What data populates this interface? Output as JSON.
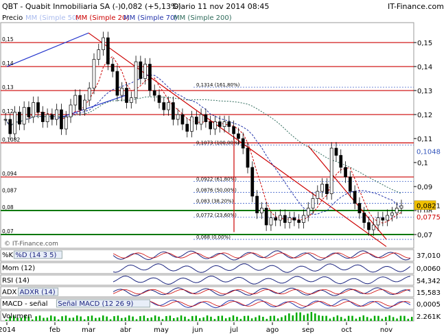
{
  "header": {
    "ticker": "QBT - Quabit Inmobiliaria SA (-)",
    "quote": "0,082 (+5,13%)",
    "period": "Diario",
    "datetime": "11 nov 2014 08:45",
    "source": "IT-Finance.com"
  },
  "legend": {
    "precio": "Precio",
    "mm50": "MM (Simple 50)",
    "mm20": "MM (Simple 20)",
    "mm70": "MM (Simple 70)",
    "mm200": "MM (Simple 200)"
  },
  "watermark": "© IT-Finance.com",
  "chart_data": {
    "type": "candlestick",
    "period": "Diario",
    "y_axis_labels": [
      "0,15",
      "0,14",
      "0,13",
      "0,12",
      "0,11",
      "0,1",
      "0,09",
      "0,08",
      "0,07"
    ],
    "y_axis_values": [
      0.15,
      0.14,
      0.13,
      0.12,
      0.11,
      0.1,
      0.09,
      0.08,
      0.07
    ],
    "ylim": [
      0.0643,
      0.1583
    ],
    "x_axis_labels": [
      "2014",
      "feb",
      "mar",
      "abr",
      "may",
      "jun",
      "jul",
      "ago",
      "sep",
      "oct",
      "nov"
    ],
    "left_labels": [
      {
        "text": "0,15",
        "value": 0.15
      },
      {
        "text": "0,14",
        "value": 0.14
      },
      {
        "text": "0,13",
        "value": 0.13
      },
      {
        "text": "0,12",
        "value": 0.12
      },
      {
        "text": "0,1082",
        "value": 0.1082
      },
      {
        "text": "0,094",
        "value": 0.094
      },
      {
        "text": "0,087",
        "value": 0.087
      },
      {
        "text": "0,08",
        "value": 0.08
      },
      {
        "text": "0,07",
        "value": 0.07
      }
    ],
    "last_price": {
      "label": "0,0821",
      "value": 0.0821,
      "color": "#f0c000"
    },
    "price_tags": [
      {
        "label": "0,1048",
        "value": 0.1048,
        "color": "#3355bb"
      },
      {
        "label": "0,0775",
        "value": 0.0775,
        "color": "#cc0000"
      }
    ],
    "fibonacci": [
      {
        "label": "0,1314 (161,80%)",
        "value": 0.1314
      },
      {
        "label": "0,1073 (100,00%)",
        "value": 0.1073
      },
      {
        "label": "0,0922 (61,80%)",
        "value": 0.0922
      },
      {
        "label": "0,0876 (50,00%)",
        "value": 0.0876
      },
      {
        "label": "0,083 (38,20%)",
        "value": 0.083
      },
      {
        "label": "0,0772 (23,60%)",
        "value": 0.0772
      },
      {
        "label": "0,068 (0,00%)",
        "value": 0.068
      }
    ],
    "horizontal_lines": [
      {
        "value": 0.15,
        "color": "#cc0000"
      },
      {
        "value": 0.14,
        "color": "#cc0000"
      },
      {
        "value": 0.13,
        "color": "#cc0000"
      },
      {
        "value": 0.12,
        "color": "#cc0000"
      },
      {
        "value": 0.1082,
        "color": "#cc0000"
      },
      {
        "value": 0.094,
        "color": "#cc0000"
      },
      {
        "value": 0.08,
        "color": "#007700"
      },
      {
        "value": 0.07,
        "color": "#007700"
      }
    ],
    "close_series": [
      0.118,
      0.112,
      0.121,
      0.116,
      0.123,
      0.119,
      0.125,
      0.121,
      0.117,
      0.12,
      0.118,
      0.122,
      0.114,
      0.119,
      0.124,
      0.128,
      0.122,
      0.126,
      0.131,
      0.143,
      0.147,
      0.152,
      0.141,
      0.138,
      0.128,
      0.131,
      0.125,
      0.127,
      0.142,
      0.135,
      0.141,
      0.13,
      0.128,
      0.125,
      0.122,
      0.125,
      0.118,
      0.12,
      0.116,
      0.113,
      0.119,
      0.116,
      0.12,
      0.117,
      0.114,
      0.117,
      0.115,
      0.117,
      0.115,
      0.112,
      0.11,
      0.106,
      0.098,
      0.086,
      0.079,
      0.081,
      0.074,
      0.077,
      0.076,
      0.078,
      0.075,
      0.077,
      0.076,
      0.075,
      0.078,
      0.081,
      0.085,
      0.088,
      0.091,
      0.087,
      0.106,
      0.103,
      0.098,
      0.094,
      0.088,
      0.083,
      0.079,
      0.075,
      0.072,
      0.074,
      0.077,
      0.076,
      0.078,
      0.079,
      0.081,
      0.082
    ],
    "support_resistance_lines": [
      {
        "color": "#2233cc",
        "from": [
          "2014",
          0.14
        ],
        "to": [
          "mar",
          0.154
        ]
      },
      {
        "color": "#2233cc",
        "from": [
          "feb",
          0.118
        ],
        "to": [
          "abr",
          0.128
        ]
      },
      {
        "color": "#cc0000",
        "from": [
          "mar",
          0.154
        ],
        "to": [
          "nov",
          0.065
        ]
      },
      {
        "color": "#cc0000",
        "from": [
          "jul",
          0.111
        ],
        "to": [
          "jul",
          0.071
        ]
      },
      {
        "color": "#cc0000",
        "from": [
          "sep",
          0.107
        ],
        "to": [
          "nov",
          0.068
        ]
      }
    ]
  },
  "indicators": [
    {
      "label": "%K",
      "extra": "%D (14 3 5)",
      "value": "37,010"
    },
    {
      "label": "Mom (12)",
      "extra": "",
      "value": "0,0060"
    },
    {
      "label": "RSI (14)",
      "extra": "",
      "value": "54,342"
    },
    {
      "label": "ADX",
      "extra": "ADXR (14)",
      "value": "15,583"
    },
    {
      "label": "MACD - señal",
      "extra": "Señal   MACD (12 26 9)",
      "value": "0,0005"
    },
    {
      "label": "Volumen",
      "extra": "",
      "value": "2.261K"
    }
  ],
  "colors": {
    "accent_blue": "#3355bb",
    "accent_red": "#cc0000",
    "up_candle": "#ffffff",
    "down_candle": "#000000",
    "last_price_bg": "#f0c000",
    "volume": "#00aa00"
  }
}
